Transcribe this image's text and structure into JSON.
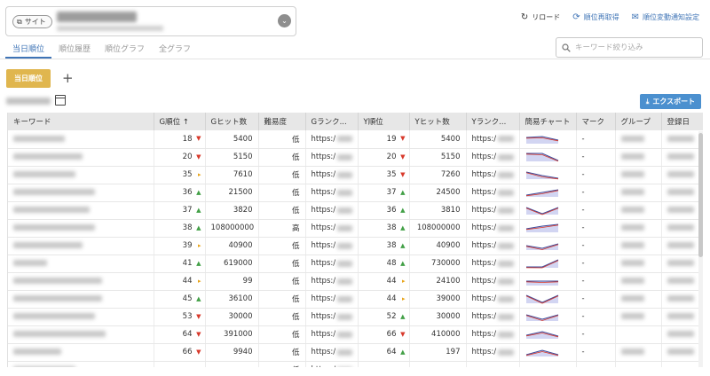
{
  "site": {
    "badge": "サイト"
  },
  "actions": {
    "reload": "リロード",
    "refetch": "順位再取得",
    "notify": "順位変動通知設定"
  },
  "tabs": [
    "当日順位",
    "順位履歴",
    "順位グラフ",
    "全グラフ"
  ],
  "search": {
    "placeholder": "キーワード絞り込み"
  },
  "filter": {
    "chip": "当日順位",
    "add": "+"
  },
  "export": {
    "label": "エクスポート"
  },
  "table": {
    "headers": {
      "keyword": "キーワード",
      "g_rank": "G順位 ↑",
      "g_hits": "Gヒット数",
      "difficulty": "難易度",
      "g_url": "Gランク...",
      "y_rank": "Y順位",
      "y_hits": "Yヒット数",
      "y_url": "Yランク...",
      "chart": "簡易チャート",
      "mark": "マーク",
      "group": "グループ",
      "registered": "登録日"
    },
    "url_prefix": "https:/",
    "rows": [
      {
        "g": "18",
        "gt": "down",
        "gh": "5400",
        "d": "低",
        "y": "19",
        "yt": "down",
        "yh": "5400",
        "m": "-",
        "grp": true,
        "spark": [
          [
            0,
            3
          ],
          [
            1,
            2
          ],
          [
            2,
            6
          ]
        ]
      },
      {
        "g": "20",
        "gt": "down",
        "gh": "5150",
        "d": "低",
        "y": "20",
        "yt": "down",
        "yh": "5150",
        "m": "-",
        "grp": true,
        "spark": [
          [
            0,
            1
          ],
          [
            1,
            1
          ],
          [
            2,
            9
          ]
        ]
      },
      {
        "g": "35",
        "gt": "right",
        "gh": "7610",
        "d": "低",
        "y": "35",
        "yt": "down",
        "yh": "7260",
        "m": "-",
        "grp": true,
        "spark": [
          [
            0,
            2
          ],
          [
            1,
            6
          ],
          [
            2,
            9
          ]
        ]
      },
      {
        "g": "36",
        "gt": "up",
        "gh": "21500",
        "d": "低",
        "y": "37",
        "yt": "up",
        "yh": "24500",
        "m": "-",
        "grp": true,
        "spark": [
          [
            0,
            8
          ],
          [
            1,
            5
          ],
          [
            2,
            2
          ]
        ]
      },
      {
        "g": "37",
        "gt": "up",
        "gh": "3820",
        "d": "低",
        "y": "36",
        "yt": "up",
        "yh": "3810",
        "m": "-",
        "grp": true,
        "spark": [
          [
            0,
            2
          ],
          [
            1,
            9
          ],
          [
            2,
            2
          ]
        ]
      },
      {
        "g": "38",
        "gt": "up",
        "gh": "108000000",
        "d": "高",
        "y": "38",
        "yt": "up",
        "yh": "108000000",
        "m": "-",
        "grp": true,
        "spark": [
          [
            0,
            6
          ],
          [
            1,
            3
          ],
          [
            2,
            1
          ]
        ]
      },
      {
        "g": "39",
        "gt": "right",
        "gh": "40900",
        "d": "低",
        "y": "38",
        "yt": "up",
        "yh": "40900",
        "m": "-",
        "grp": true,
        "spark": [
          [
            0,
            5
          ],
          [
            1,
            8
          ],
          [
            2,
            3
          ]
        ]
      },
      {
        "g": "41",
        "gt": "up",
        "gh": "619000",
        "d": "低",
        "y": "48",
        "yt": "up",
        "yh": "730000",
        "m": "-",
        "grp": true,
        "spark": [
          [
            0,
            9
          ],
          [
            1,
            9
          ],
          [
            2,
            1
          ]
        ]
      },
      {
        "g": "44",
        "gt": "right",
        "gh": "99",
        "d": "低",
        "y": "44",
        "yt": "right",
        "yh": "24100",
        "m": "-",
        "grp": true,
        "spark": [
          [
            0,
            5
          ],
          [
            1,
            5
          ],
          [
            2,
            5
          ]
        ]
      },
      {
        "g": "45",
        "gt": "up",
        "gh": "36100",
        "d": "低",
        "y": "44",
        "yt": "right",
        "yh": "39000",
        "m": "-",
        "grp": true,
        "spark": [
          [
            0,
            1
          ],
          [
            1,
            9
          ],
          [
            2,
            1
          ]
        ]
      },
      {
        "g": "53",
        "gt": "down",
        "gh": "30000",
        "d": "低",
        "y": "52",
        "yt": "up",
        "yh": "30000",
        "m": "-",
        "grp": true,
        "spark": [
          [
            0,
            3
          ],
          [
            1,
            8
          ],
          [
            2,
            3
          ]
        ]
      },
      {
        "g": "64",
        "gt": "down",
        "gh": "391000",
        "d": "低",
        "y": "66",
        "yt": "down",
        "yh": "410000",
        "m": "-",
        "grp": false,
        "spark": [
          [
            0,
            6
          ],
          [
            1,
            2
          ],
          [
            2,
            7
          ]
        ]
      },
      {
        "g": "66",
        "gt": "down",
        "gh": "9940",
        "d": "低",
        "y": "64",
        "yt": "up",
        "yh": "197",
        "m": "-",
        "grp": true,
        "spark": [
          [
            0,
            8
          ],
          [
            1,
            3
          ],
          [
            2,
            8
          ]
        ]
      },
      {
        "g": "",
        "gt": "",
        "gh": "",
        "d": "低",
        "y": "",
        "yt": "",
        "yh": "",
        "m": "",
        "grp": false,
        "spark": []
      }
    ]
  },
  "colors": {
    "accent": "#3f74b6",
    "chip": "#e0b64e",
    "export": "#4b90cf",
    "down": "#d8392b",
    "up": "#43a047",
    "flat": "#e8a317",
    "spark_line": "#3d4a9a",
    "spark_fill": "#c7cbef",
    "spark_red": "#d8392b"
  }
}
